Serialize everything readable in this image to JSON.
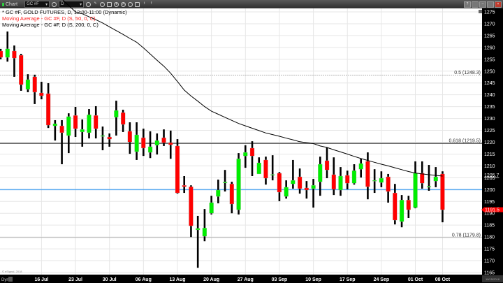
{
  "toolbar": {
    "window_label": "Chart",
    "symbol": "GC #F",
    "interval": "D",
    "icons": [
      "clock-icon",
      "pencil-icon",
      "minus-circle-icon",
      "envelope-icon",
      "record-icon",
      "alert-icon",
      "link-icon",
      "comment-icon",
      "twitter-icon",
      "facebook-icon"
    ],
    "window_buttons": [
      "help-icon",
      "restore-icon",
      "minimize-icon",
      "maximize-icon",
      "close-icon"
    ]
  },
  "legend": {
    "main": "* GC #F, GOLD FUTURES, D, 12:00-11:00 (Dynamic)",
    "ma50": "Moving Average - GC #F, D (S, 50, 0, C)",
    "ma200": "Moving Average - GC #F, D (S, 200, 0, C)"
  },
  "colors": {
    "up": "#00ee00",
    "down": "#ff0000",
    "ma50": "#ff0000",
    "ma200": "#000000",
    "level_line": "#5aaaf0",
    "axis_bg": "#000000",
    "last_price": "#ff0000"
  },
  "chart_data": {
    "type": "candlestick",
    "symbol": "GC #F",
    "ylim": [
      1165,
      1275
    ],
    "y_ticks": [
      1275,
      1270,
      1265,
      1260,
      1255,
      1250,
      1245,
      1240,
      1235,
      1230,
      1225,
      1220,
      1215,
      1210,
      1205,
      1200,
      1195,
      1190,
      1185,
      1180,
      1175,
      1170,
      1165
    ],
    "x_tick_labels": [
      "16 Jul",
      "23 Jul",
      "30 Jul",
      "06 Aug",
      "13 Aug",
      "20 Aug",
      "27 Aug",
      "03 Sep",
      "10 Sep",
      "17 Sep",
      "24 Sep",
      "01 Oct",
      "08 Oct"
    ],
    "x_tick_candle_index": [
      6,
      11,
      16,
      21,
      26,
      31,
      36,
      41,
      46,
      51,
      56,
      61,
      65
    ],
    "grid": true,
    "candles_ohlc": [
      [
        1258.5,
        1259.4,
        1255.0,
        1255.8
      ],
      [
        1255.8,
        1266.7,
        1254.0,
        1259.4
      ],
      [
        1258.5,
        1260.8,
        1247.6,
        1255.5
      ],
      [
        1256.7,
        1257.3,
        1241.7,
        1244.3
      ],
      [
        1242.3,
        1248.7,
        1241.1,
        1246.4
      ],
      [
        1247.6,
        1248.5,
        1236.1,
        1241.1
      ],
      [
        1240.8,
        1245.5,
        1238.1,
        1239.6
      ],
      [
        1240.5,
        1244.9,
        1226.0,
        1227.2
      ],
      [
        1226.9,
        1229.3,
        1220.7,
        1227.8
      ],
      [
        1226.9,
        1229.3,
        1210.7,
        1224.0
      ],
      [
        1222.8,
        1232.2,
        1215.4,
        1230.8
      ],
      [
        1231.3,
        1234.9,
        1222.2,
        1225.7
      ],
      [
        1224.3,
        1229.6,
        1218.1,
        1225.4
      ],
      [
        1224.0,
        1234.0,
        1221.6,
        1231.6
      ],
      [
        1231.3,
        1235.2,
        1221.6,
        1225.7
      ],
      [
        1222.5,
        1226.6,
        1216.6,
        1222.8
      ],
      [
        1222.2,
        1223.7,
        1218.1,
        1221.3
      ],
      [
        1230.5,
        1237.5,
        1222.8,
        1233.4
      ],
      [
        1232.5,
        1233.7,
        1224.3,
        1227.5
      ],
      [
        1224.6,
        1228.4,
        1215.1,
        1220.1
      ],
      [
        1216.0,
        1228.4,
        1212.5,
        1223.1
      ],
      [
        1221.9,
        1225.7,
        1214.2,
        1217.5
      ],
      [
        1215.7,
        1224.6,
        1213.3,
        1218.1
      ],
      [
        1218.7,
        1223.7,
        1214.8,
        1220.7
      ],
      [
        1221.9,
        1225.4,
        1218.4,
        1219.8
      ],
      [
        1219.8,
        1224.9,
        1213.0,
        1218.9
      ],
      [
        1218.4,
        1221.3,
        1198.3,
        1198.6
      ],
      [
        1201.8,
        1205.7,
        1198.6,
        1201.2
      ],
      [
        1201.2,
        1201.8,
        1180.0,
        1184.7
      ],
      [
        1183.0,
        1188.9,
        1167.0,
        1183.6
      ],
      [
        1180.3,
        1191.8,
        1178.2,
        1183.8
      ],
      [
        1190.0,
        1197.4,
        1189.5,
        1194.5
      ],
      [
        1197.1,
        1204.2,
        1194.2,
        1199.8
      ],
      [
        1202.8,
        1208.3,
        1199.2,
        1203.2
      ],
      [
        1202.4,
        1203.3,
        1190.0,
        1193.9
      ],
      [
        1191.5,
        1215.4,
        1189.5,
        1213.0
      ],
      [
        1214.2,
        1218.7,
        1209.2,
        1215.7
      ],
      [
        1217.5,
        1220.4,
        1205.7,
        1214.2
      ],
      [
        1206.6,
        1213.6,
        1206.6,
        1211.3
      ],
      [
        1212.5,
        1213.9,
        1202.1,
        1204.8
      ],
      [
        1206.1,
        1214.5,
        1203.9,
        1206.4
      ],
      [
        1206.9,
        1207.4,
        1195.1,
        1198.9
      ],
      [
        1197.1,
        1203.9,
        1196.2,
        1201.0
      ],
      [
        1202.4,
        1212.5,
        1200.4,
        1203.9
      ],
      [
        1205.4,
        1208.9,
        1198.3,
        1200.4
      ],
      [
        1200.7,
        1203.6,
        1196.2,
        1199.8
      ],
      [
        1200.4,
        1204.5,
        1192.4,
        1201.8
      ],
      [
        1203.3,
        1213.9,
        1197.4,
        1210.7
      ],
      [
        1212.2,
        1217.8,
        1204.8,
        1208.3
      ],
      [
        1206.3,
        1213.6,
        1197.7,
        1200.1
      ],
      [
        1199.8,
        1209.5,
        1197.4,
        1205.7
      ],
      [
        1206.0,
        1208.0,
        1200.1,
        1202.7
      ],
      [
        1202.7,
        1210.7,
        1202.1,
        1208.0
      ],
      [
        1208.6,
        1213.0,
        1205.1,
        1211.0
      ],
      [
        1211.9,
        1215.7,
        1195.9,
        1201.2
      ],
      [
        1203.7,
        1208.6,
        1198.6,
        1203.9
      ],
      [
        1203.0,
        1207.7,
        1201.0,
        1204.8
      ],
      [
        1205.4,
        1206.6,
        1194.5,
        1199.2
      ],
      [
        1198.6,
        1202.4,
        1185.3,
        1187.1
      ],
      [
        1186.5,
        1197.7,
        1184.1,
        1195.6
      ],
      [
        1195.6,
        1197.4,
        1188.0,
        1191.5
      ],
      [
        1192.4,
        1211.9,
        1192.1,
        1206.9
      ],
      [
        1206.9,
        1211.9,
        1200.4,
        1202.7
      ],
      [
        1201.0,
        1210.4,
        1199.5,
        1201.4
      ],
      [
        1203.6,
        1209.5,
        1201.0,
        1205.4
      ],
      [
        1206.6,
        1207.7,
        1186.2,
        1191.5
      ]
    ],
    "ma200": [
      null,
      null,
      null,
      null,
      null,
      null,
      null,
      null,
      null,
      null,
      null,
      1275.0,
      1274.2,
      1272.9,
      1271.7,
      1270.3,
      1268.7,
      1267.1,
      1265.5,
      1263.8,
      1262.2,
      1259.8,
      1257.2,
      1254.6,
      1252.1,
      1249.1,
      1245.6,
      1242.0,
      1239.5,
      1237.3,
      1235.0,
      1233.1,
      1231.8,
      1230.5,
      1229.2,
      1227.9,
      1226.9,
      1225.9,
      1224.9,
      1223.9,
      1223.2,
      1222.5,
      1221.7,
      1221.0,
      1220.2,
      1219.8,
      1219.4,
      1218.4,
      1217.8,
      1216.8,
      1215.9,
      1215.0,
      1214.0,
      1213.1,
      1212.3,
      1211.5,
      1210.7,
      1210.0,
      1209.2,
      1208.4,
      1207.6,
      1207.0,
      1206.6,
      1206.3,
      1206.0,
      1205.7
    ],
    "horizontal_lines": [
      {
        "price": 1248.3,
        "label": "0.5 (1248.3)",
        "style": "dashed"
      },
      {
        "price": 1219.5,
        "label": "0.618 (1219.5)",
        "style": "solid-dark"
      },
      {
        "price": 1179.8,
        "label": "0.78 (1179.8)",
        "style": "solid-light"
      },
      {
        "price": 1200.0,
        "label": "",
        "style": "blue"
      }
    ],
    "ma200_last_label": "1205.7",
    "last_price_label": "1191.5"
  },
  "bottom_bar": {
    "mode_label": "Dyn",
    "date_box": "10/15/2018"
  },
  "watermark": "© eSignal, 2018"
}
